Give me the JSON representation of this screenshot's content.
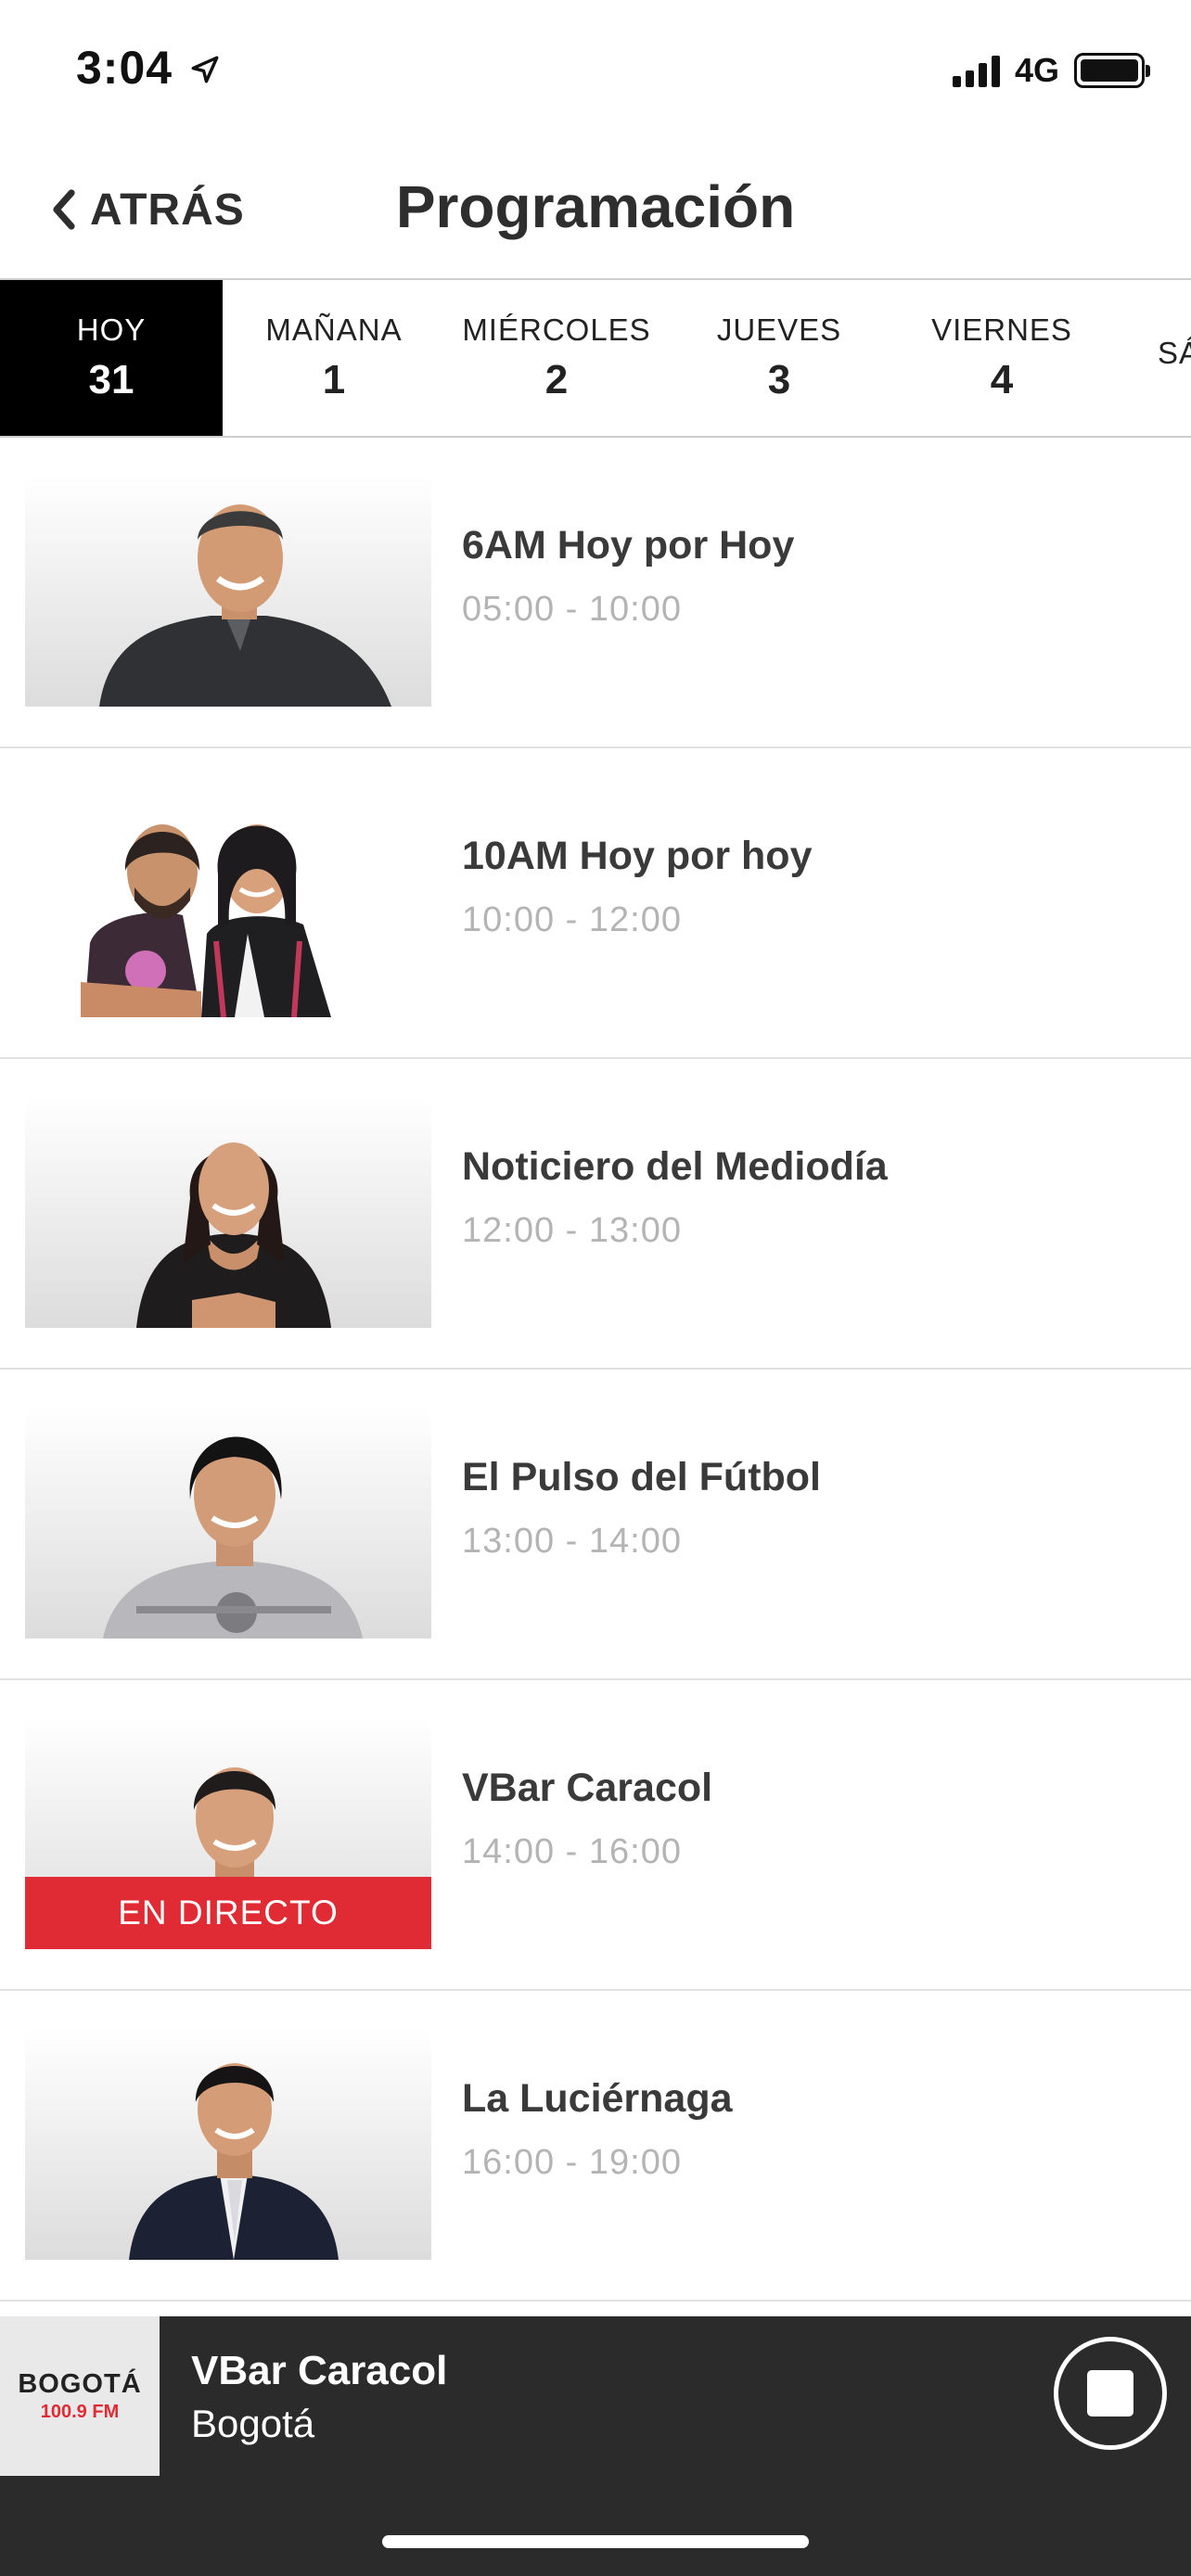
{
  "status_bar": {
    "time": "3:04",
    "location_icon": "location-arrow-icon",
    "network": "4G",
    "signal_icon": "cellular-signal-icon",
    "battery_icon": "battery-icon"
  },
  "nav": {
    "back_label": "ATRÁS",
    "back_icon": "chevron-left-icon",
    "title": "Programación"
  },
  "days": [
    {
      "name": "HOY",
      "number": "31",
      "active": true
    },
    {
      "name": "MAÑANA",
      "number": "1",
      "active": false
    },
    {
      "name": "MIÉRCOLES",
      "number": "2",
      "active": false
    },
    {
      "name": "JUEVES",
      "number": "3",
      "active": false
    },
    {
      "name": "VIERNES",
      "number": "4",
      "active": false
    },
    {
      "name": "SÁ",
      "number": "",
      "active": false
    }
  ],
  "programs": [
    {
      "title": "6AM Hoy por Hoy",
      "time": "05:00 - 10:00",
      "live": false
    },
    {
      "title": "10AM Hoy por hoy",
      "time": "10:00 - 12:00",
      "live": false
    },
    {
      "title": "Noticiero del Mediodía",
      "time": "12:00 - 13:00",
      "live": false
    },
    {
      "title": "El Pulso del Fútbol",
      "time": "13:00 - 14:00",
      "live": false
    },
    {
      "title": "VBar Caracol",
      "time": "14:00 - 16:00",
      "live": true,
      "live_label": "EN DIRECTO"
    },
    {
      "title": "La Luciérnaga",
      "time": "16:00 - 19:00",
      "live": false
    }
  ],
  "now_playing": {
    "title": "VBar Caracol",
    "subtitle": "Bogotá",
    "station_logo_name": "BOGOTÁ",
    "station_logo_freq": "100.9 FM",
    "stop_icon": "stop-icon"
  },
  "colors": {
    "live_red": "#e02b34",
    "player_bg": "#2b2b2b",
    "active_tab_bg": "#000000",
    "time_gray": "#b4b4b4"
  }
}
